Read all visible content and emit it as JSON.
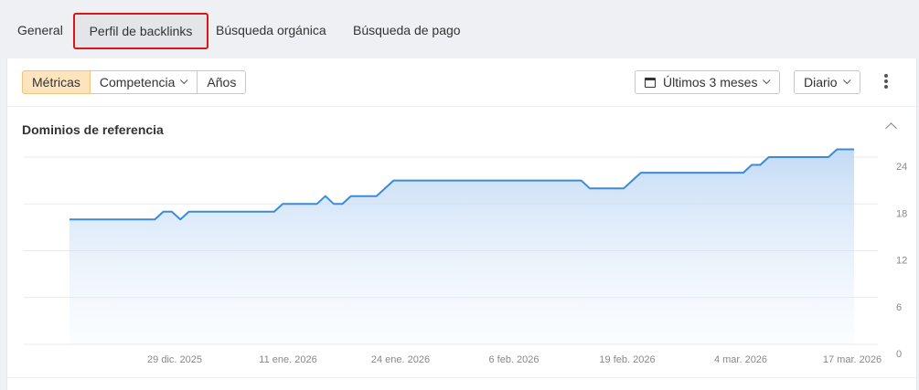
{
  "tabs": [
    "General",
    "Perfil de backlinks",
    "Búsqueda orgánica",
    "Búsqueda de pago"
  ],
  "toolbar": {
    "segments": [
      "Métricas",
      "Competencia",
      "Años"
    ],
    "range_label": "Últimos 3 meses",
    "period_label": "Diario"
  },
  "section": {
    "title": "Dominios de referencia"
  },
  "colors": {
    "accent": "#3c8bd9",
    "active_segment": "#fde4bd",
    "highlight_border": "#d9161a"
  },
  "chart_data": {
    "type": "area",
    "title": "Dominios de referencia",
    "x_tick_labels": [
      "29 dic. 2025",
      "11 ene. 2026",
      "24 ene. 2026",
      "6 feb. 2026",
      "19 feb. 2026",
      "4 mar. 2026",
      "17 mar. 2026"
    ],
    "y_ticks": [
      24,
      18,
      12,
      6,
      0
    ],
    "ylim": [
      0,
      24
    ],
    "grid": true,
    "series": [
      {
        "points": [
          [
            "2025-12-17",
            16
          ],
          [
            "2025-12-27",
            16
          ],
          [
            "2025-12-28",
            17
          ],
          [
            "2025-12-29",
            17
          ],
          [
            "2025-12-30",
            16
          ],
          [
            "2025-12-31",
            17
          ],
          [
            "2026-01-10",
            17
          ],
          [
            "2026-01-11",
            18
          ],
          [
            "2026-01-15",
            18
          ],
          [
            "2026-01-16",
            19
          ],
          [
            "2026-01-17",
            18
          ],
          [
            "2026-01-18",
            18
          ],
          [
            "2026-01-19",
            19
          ],
          [
            "2026-01-22",
            19
          ],
          [
            "2026-01-24",
            21
          ],
          [
            "2026-02-15",
            21
          ],
          [
            "2026-02-16",
            20
          ],
          [
            "2026-02-20",
            20
          ],
          [
            "2026-02-21",
            21
          ],
          [
            "2026-02-22",
            22
          ],
          [
            "2026-03-06",
            22
          ],
          [
            "2026-03-07",
            23
          ],
          [
            "2026-03-08",
            23
          ],
          [
            "2026-03-09",
            24
          ],
          [
            "2026-03-16",
            24
          ],
          [
            "2026-03-17",
            25
          ],
          [
            "2026-03-19",
            25
          ]
        ]
      }
    ]
  }
}
